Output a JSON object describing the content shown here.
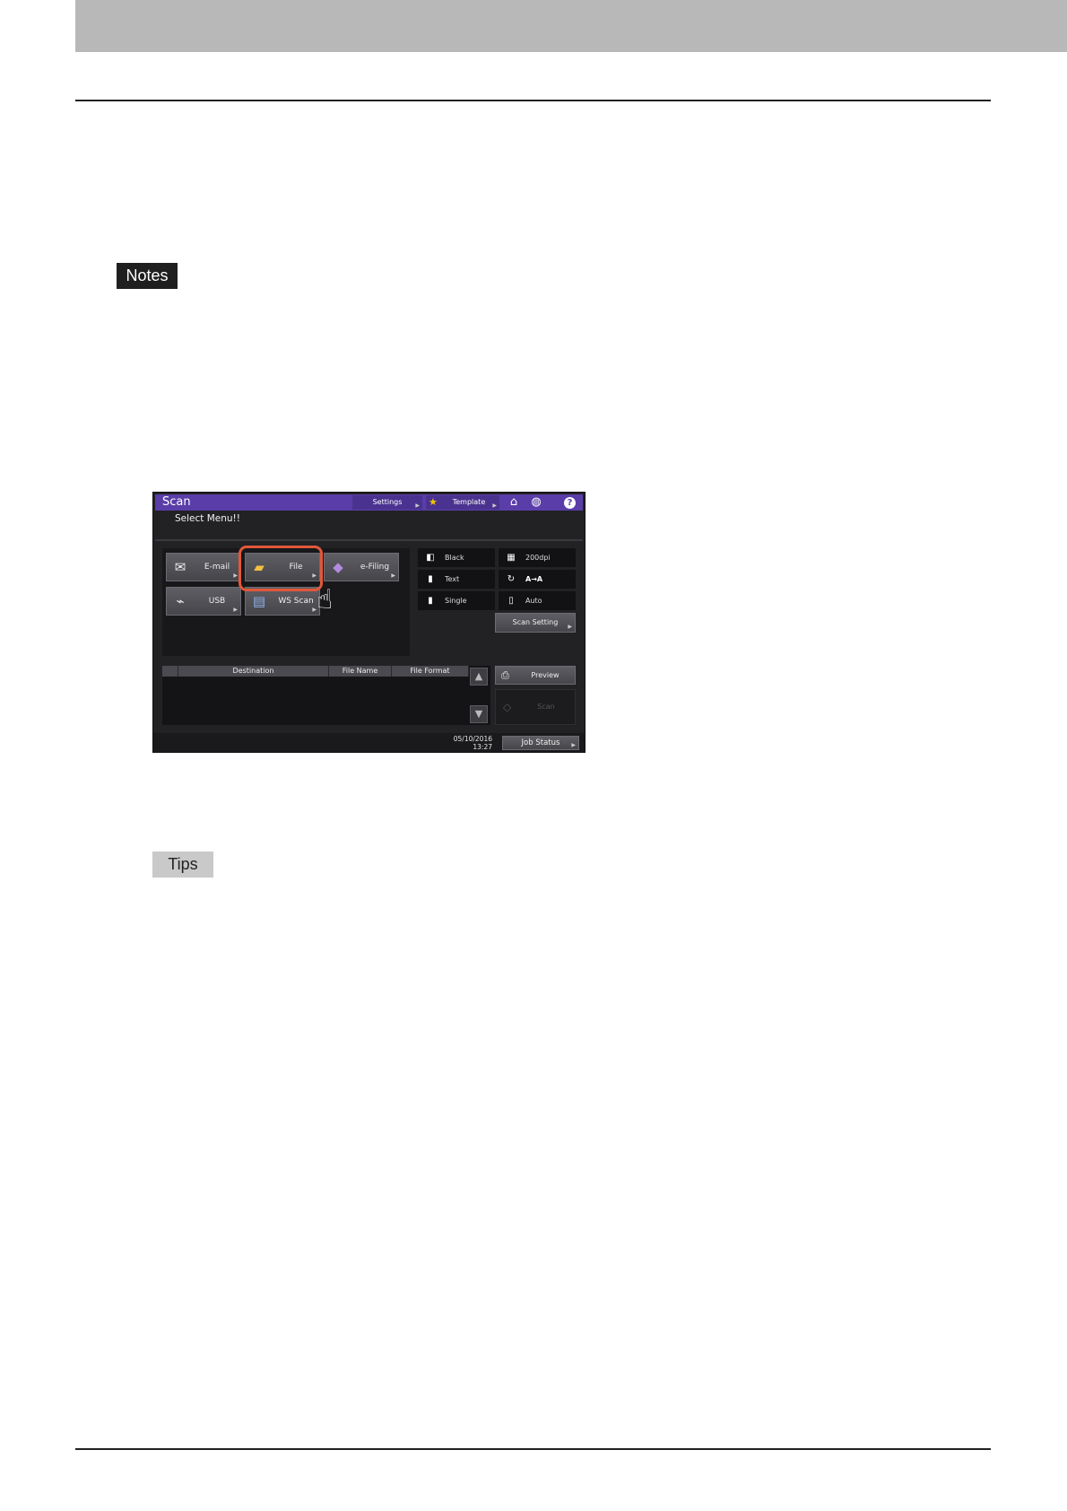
{
  "labels": {
    "notes": "Notes",
    "tips": "Tips"
  },
  "screen": {
    "title": "Scan",
    "header_buttons": {
      "settings": "Settings",
      "template": "Template"
    },
    "subtitle": "Select Menu!!",
    "menu": {
      "email": "E-mail",
      "file": "File",
      "efiling": "e-Filing",
      "usb": "USB",
      "wsscan": "WS Scan"
    },
    "settings": {
      "color": "Black",
      "resolution": "200dpi",
      "mode": "Text",
      "rotation_value": "A→A",
      "sides": "Single",
      "size": "Auto"
    },
    "scan_setting": "Scan Setting",
    "table_headers": {
      "destination": "Destination",
      "file_name": "File Name",
      "file_format": "File Format"
    },
    "preview": "Preview",
    "scan": "Scan",
    "date": "05/10/2016",
    "time": "13:27",
    "job_status": "Job Status",
    "colors": {
      "header": "#5a3da8",
      "highlight": "#e2583a"
    },
    "icons": [
      "email-icon",
      "folder-icon",
      "efiling-icon",
      "usb-icon",
      "wsscan-icon",
      "star-icon",
      "home-icon",
      "globe-icon",
      "help-icon",
      "hand-pointer-icon"
    ]
  }
}
